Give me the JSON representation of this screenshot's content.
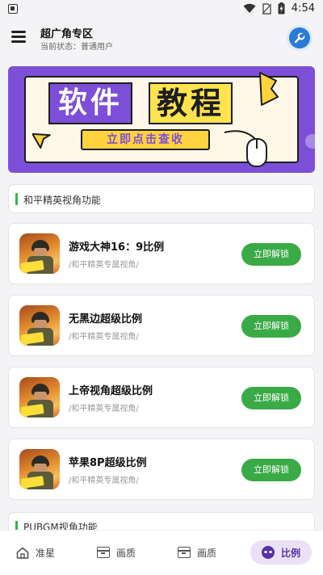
{
  "status_bar": {
    "time": "4:54"
  },
  "header": {
    "title": "超广角专区",
    "subtitle": "当前状态：普通用户"
  },
  "banner": {
    "text_left": "软件",
    "text_right": "教程",
    "button_label": "立即点击查收"
  },
  "section1": {
    "title": "和平精英视角功能"
  },
  "games": [
    {
      "name": "游戏大神16：9比例",
      "subtitle": "/和平精英专属视角/",
      "button": "立即解锁"
    },
    {
      "name": "无黑边超级比例",
      "subtitle": "/和平精英专属视角/",
      "button": "立即解锁"
    },
    {
      "name": "上帝视角超级比例",
      "subtitle": "/和平精英专属视角/",
      "button": "立即解锁"
    },
    {
      "name": "苹果8P超级比例",
      "subtitle": "/和平精英专属视角/",
      "button": "立即解锁"
    }
  ],
  "section2": {
    "title": "PUBGM视角功能"
  },
  "tabs": [
    {
      "label": "准星",
      "icon": "home-icon"
    },
    {
      "label": "画质",
      "icon": "box-icon"
    },
    {
      "label": "画质",
      "icon": "box-icon"
    },
    {
      "label": "比例",
      "icon": "alien-icon",
      "active": true
    }
  ],
  "colors": {
    "accent_green": "#3aaa46",
    "accent_purple": "#7d4fd8",
    "banner_yellow": "#ffd33d",
    "wrench_blue": "#2b7bd6"
  }
}
